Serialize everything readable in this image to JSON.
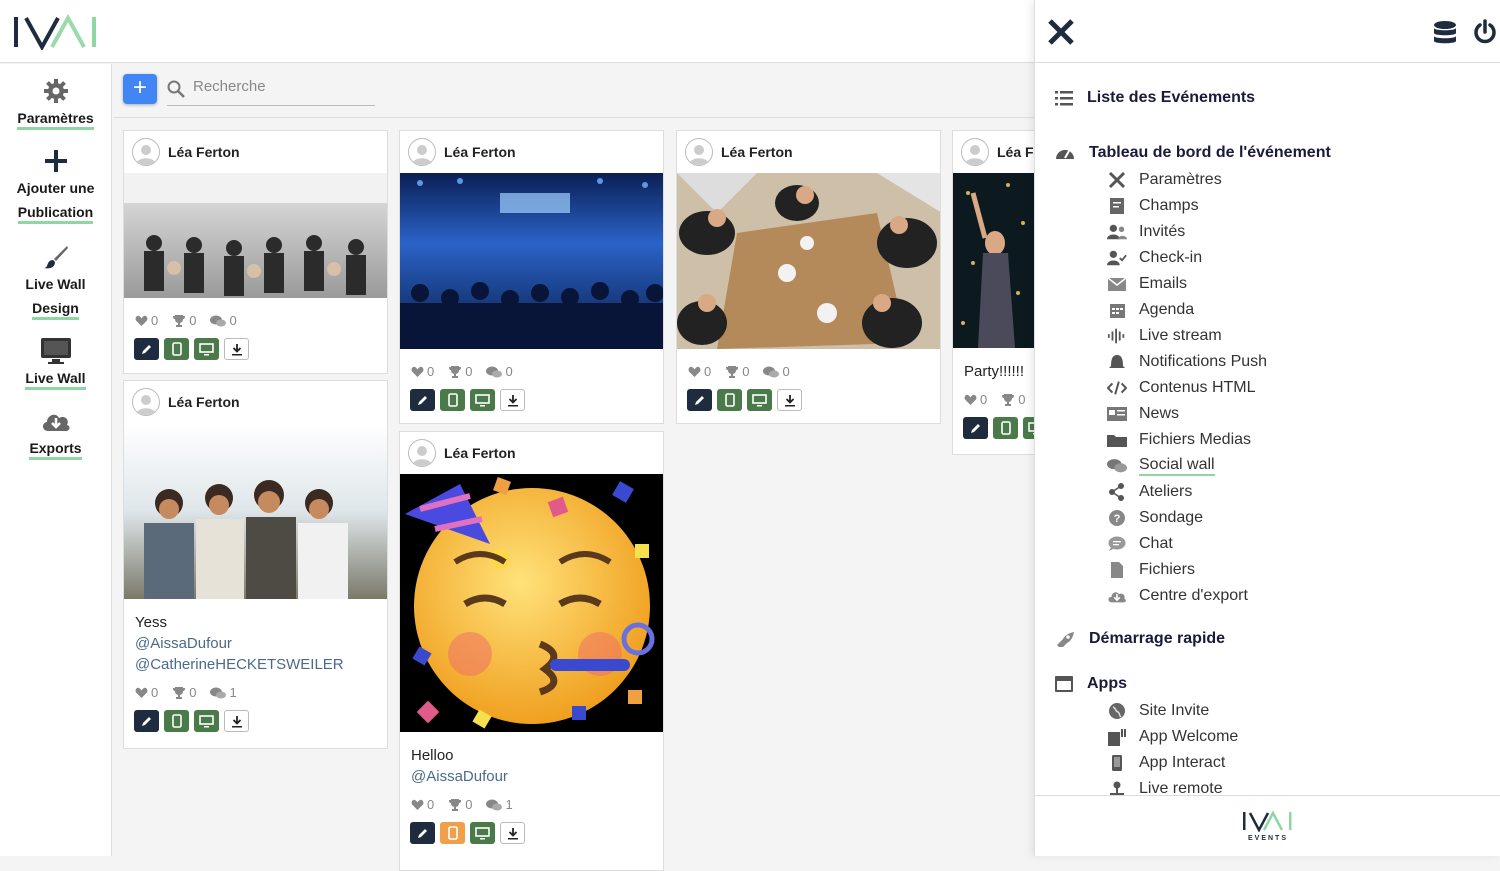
{
  "sidebar": {
    "items": [
      {
        "label": "Paramètres"
      },
      {
        "label_line1": "Ajouter une",
        "label_line2": "Publication"
      },
      {
        "label_line1": "Live Wall",
        "label_line2": "Design"
      },
      {
        "label": "Live Wall"
      },
      {
        "label": "Exports"
      }
    ]
  },
  "search": {
    "placeholder": "Recherche",
    "add_label": "+"
  },
  "posts": [
    {
      "author": "Léa Ferton",
      "text": "",
      "mentions": [],
      "likes": "0",
      "trophies": "0",
      "comments": "0"
    },
    {
      "author": "Léa Ferton",
      "text": "Yess",
      "mentions": [
        "@AissaDufour",
        "@CatherineHECKETSWEILER"
      ],
      "likes": "0",
      "trophies": "0",
      "comments": "1"
    },
    {
      "author": "Léa Ferton",
      "text": "",
      "mentions": [],
      "likes": "0",
      "trophies": "0",
      "comments": "0"
    },
    {
      "author": "Léa Ferton",
      "text": "Helloo",
      "mentions": [
        "@AissaDufour"
      ],
      "likes": "0",
      "trophies": "0",
      "comments": "1"
    },
    {
      "author": "Léa Ferton",
      "text": "",
      "mentions": [],
      "likes": "0",
      "trophies": "0",
      "comments": "0"
    },
    {
      "author": "Léa Fe",
      "text": "Party!!!!!!",
      "mentions": [],
      "likes": "0",
      "trophies": "0",
      "comments": ""
    }
  ],
  "panel": {
    "sections": {
      "events_list": "Liste des Evénements",
      "dashboard": "Tableau de bord de l'événement",
      "quickstart": "Démarrage rapide",
      "apps": "Apps"
    },
    "dashboard_items": [
      {
        "label": "Paramètres",
        "icon": "tools-icon"
      },
      {
        "label": "Champs",
        "icon": "form-icon"
      },
      {
        "label": "Invités",
        "icon": "users-icon"
      },
      {
        "label": "Check-in",
        "icon": "user-check-icon"
      },
      {
        "label": "Emails",
        "icon": "envelope-icon"
      },
      {
        "label": "Agenda",
        "icon": "calendar-icon"
      },
      {
        "label": "Live stream",
        "icon": "waveform-icon"
      },
      {
        "label": "Notifications Push",
        "icon": "bell-icon"
      },
      {
        "label": "Contenus HTML",
        "icon": "code-icon"
      },
      {
        "label": "News",
        "icon": "newspaper-icon"
      },
      {
        "label": "Fichiers Medias",
        "icon": "folder-icon"
      },
      {
        "label": "Social wall",
        "icon": "comments-icon"
      },
      {
        "label": "Ateliers",
        "icon": "share-nodes-icon"
      },
      {
        "label": "Sondage",
        "icon": "question-icon"
      },
      {
        "label": "Chat",
        "icon": "chat-icon"
      },
      {
        "label": "Fichiers",
        "icon": "file-icon"
      },
      {
        "label": "Centre d'export",
        "icon": "cloud-download-icon"
      }
    ],
    "apps_items": [
      {
        "label": "Site Invite",
        "icon": "globe-icon"
      },
      {
        "label": "App Welcome",
        "icon": "device-icon"
      },
      {
        "label": "App Interact",
        "icon": "phone-icon"
      },
      {
        "label": "Live remote",
        "icon": "joystick-icon"
      }
    ],
    "footer_logo_text": "EVENTS"
  },
  "colors": {
    "accent_blue": "#4285f4",
    "nav_dark": "#1f2b3e",
    "action_green": "#4b7a4a",
    "action_orange": "#f0a04b",
    "underline_green": "#8fd6a2"
  }
}
